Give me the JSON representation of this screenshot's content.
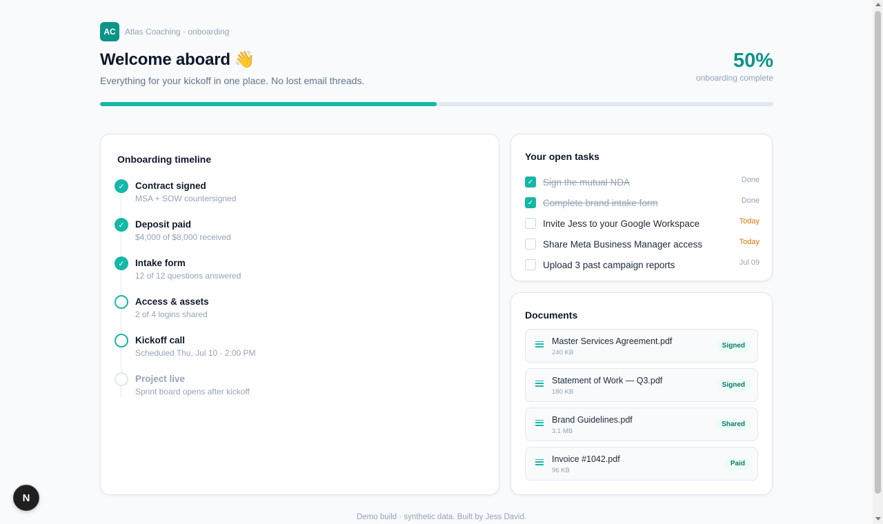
{
  "brand": {
    "initials": "AC",
    "name": "Atlas Coaching · onboarding"
  },
  "header": {
    "title": "Welcome aboard",
    "title_emoji": "👋",
    "subtitle": "Everything for your kickoff in one place. No lost email threads.",
    "progress_value": "50%",
    "progress_label": "onboarding complete",
    "progress_fraction": 0.5
  },
  "timeline": {
    "title": "Onboarding timeline",
    "items": [
      {
        "name": "Contract signed",
        "detail": "MSA + SOW countersigned",
        "state": "done"
      },
      {
        "name": "Deposit paid",
        "detail": "$4,000 of $8,000 received",
        "state": "done"
      },
      {
        "name": "Intake form",
        "detail": "12 of 12 questions answered",
        "state": "done"
      },
      {
        "name": "Access & assets",
        "detail": "2 of 4 logins shared",
        "state": "active"
      },
      {
        "name": "Kickoff call",
        "detail": "Scheduled Thu, Jul 10 · 2:00 PM",
        "state": "active"
      },
      {
        "name": "Project live",
        "detail": "Sprint board opens after kickoff",
        "state": "pending"
      }
    ]
  },
  "tasks": {
    "title": "Your open tasks",
    "items": [
      {
        "label": "Sign the mutual NDA",
        "meta": "Done",
        "checked": true
      },
      {
        "label": "Complete brand intake form",
        "meta": "Done",
        "checked": true
      },
      {
        "label": "Invite Jess to your Google Workspace",
        "meta": "Today",
        "checked": false
      },
      {
        "label": "Share Meta Business Manager access",
        "meta": "Today",
        "checked": false
      },
      {
        "label": "Upload 3 past campaign reports",
        "meta": "Jul 09",
        "checked": false
      }
    ]
  },
  "documents": {
    "title": "Documents",
    "items": [
      {
        "name": "Master Services Agreement.pdf",
        "size": "240 KB",
        "status": "Signed"
      },
      {
        "name": "Statement of Work — Q3.pdf",
        "size": "180 KB",
        "status": "Signed"
      },
      {
        "name": "Brand Guidelines.pdf",
        "size": "3.1 MB",
        "status": "Shared"
      },
      {
        "name": "Invoice #1042.pdf",
        "size": "96 KB",
        "status": "Paid"
      }
    ]
  },
  "footer": {
    "text": "Demo build · synthetic data. Built by Jess David."
  },
  "dev_badge": {
    "letter": "N"
  },
  "colors": {
    "accent": "#14b8a6",
    "accent_dark": "#0d9488",
    "warning": "#d97706",
    "muted": "#94a3b8"
  }
}
